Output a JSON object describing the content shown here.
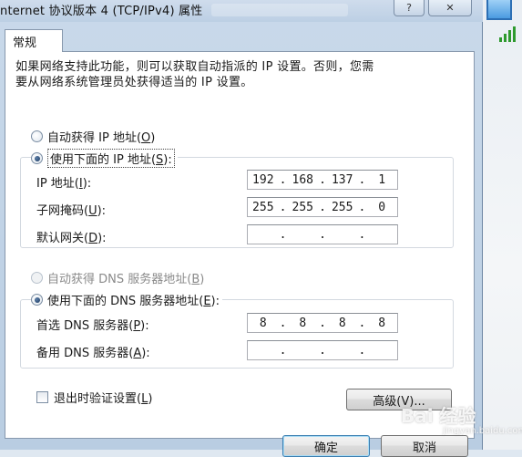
{
  "window": {
    "title": "nternet 协议版本 4 (TCP/IPv4) 属性",
    "help_glyph": "?",
    "close_glyph": "✕"
  },
  "tabs": [
    {
      "label": "常规"
    }
  ],
  "description": {
    "line1": "如果网络支持此功能，则可以获取自动指派的 IP 设置。否则，您需",
    "line2": "要从网络系统管理员处获得适当的 IP 设置。"
  },
  "ip_section": {
    "auto_label": "自动获得 IP 地址(",
    "auto_key": "O",
    "manual_label": "使用下面的 IP 地址(",
    "manual_key": "S",
    "manual_suffix": "):",
    "selected": "manual",
    "fields": [
      {
        "label": "IP 地址(",
        "key": "I",
        "suffix": "):",
        "octets": [
          "192",
          "168",
          "137",
          "1"
        ]
      },
      {
        "label": "子网掩码(",
        "key": "U",
        "suffix": "):",
        "octets": [
          "255",
          "255",
          "255",
          "0"
        ]
      },
      {
        "label": "默认网关(",
        "key": "D",
        "suffix": "):",
        "octets": [
          "",
          "",
          "",
          ""
        ]
      }
    ]
  },
  "dns_section": {
    "auto_label": "自动获得 DNS 服务器地址(",
    "auto_key": "B",
    "manual_label": "使用下面的 DNS 服务器地址(",
    "manual_key": "E",
    "manual_suffix": "):",
    "selected": "manual",
    "fields": [
      {
        "label": "首选 DNS 服务器(",
        "key": "P",
        "suffix": "):",
        "octets": [
          "8",
          "8",
          "8",
          "8"
        ]
      },
      {
        "label": "备用 DNS 服务器(",
        "key": "A",
        "suffix": "):",
        "octets": [
          "",
          "",
          "",
          ""
        ]
      }
    ]
  },
  "validate_checkbox": {
    "label": "退出时验证设置(",
    "key": "L",
    "suffix": ")",
    "checked": false
  },
  "buttons": {
    "advanced": "高级(V)...",
    "ok": "确定",
    "cancel": "取消"
  },
  "watermark": {
    "text": "Bai  经验",
    "sub": "jingyan.baidu.com"
  },
  "colors": {
    "accent": "#3c7fb1",
    "radio_dot": "#1d3a61"
  }
}
